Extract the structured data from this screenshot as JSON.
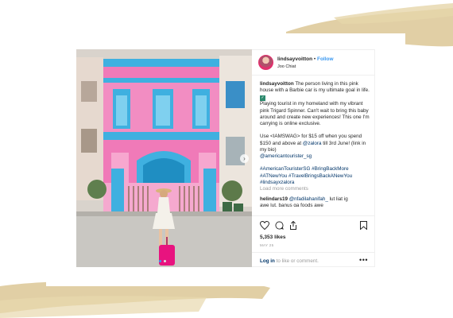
{
  "post": {
    "username": "lindsayvoitton",
    "separator": "•",
    "follow_label": "Follow",
    "location": "Joo Chiat",
    "caption_username": "lindsayvoitton",
    "caption_lines": [
      "The person living in this pink house with a Barbie car is my ultimate goal in life.",
      "Playing tourist in my homeland with my vibrant pink Trigard Spinner. Can't wait to bring this baby around and create new experiences! This one I'm carrying is online exclusive."
    ],
    "promo_lines": [
      "Use <IAMSWAG> for $15 off when you spend $150 and above at",
      "@zalora",
      "till 3rd June! (link in my bio)",
      "@americantourister_sg"
    ],
    "hashtags": "#AmericanTouristerSG #BringBackMore #ATNewYou #TravelBringsBackANewYou #lindsayxzalora",
    "load_more": "Load more comments",
    "comment_user": "helindars19",
    "comment_mention": "@nfadilahanifah_",
    "comment_text": "lut liat ig",
    "comment_cut_text": "awe lut, banus ga foods awe",
    "likes": "5,353 likes",
    "date": "MAY 25",
    "login_link": "Log in",
    "login_rest": "to like or comment.",
    "more_label": "•••",
    "next_arrow": "›"
  },
  "icons": {
    "like": "heart-icon",
    "comment": "comment-icon",
    "share": "share-icon",
    "save": "bookmark-icon",
    "verified_emoji": "check-emoji-icon"
  },
  "colors": {
    "follow_blue": "#3897f0",
    "link_blue": "#003569",
    "house_pink": "#f07ab8",
    "house_blue": "#3fb0e0",
    "suitcase_pink": "#e8137f",
    "brush_gold": "#d8c28a"
  }
}
